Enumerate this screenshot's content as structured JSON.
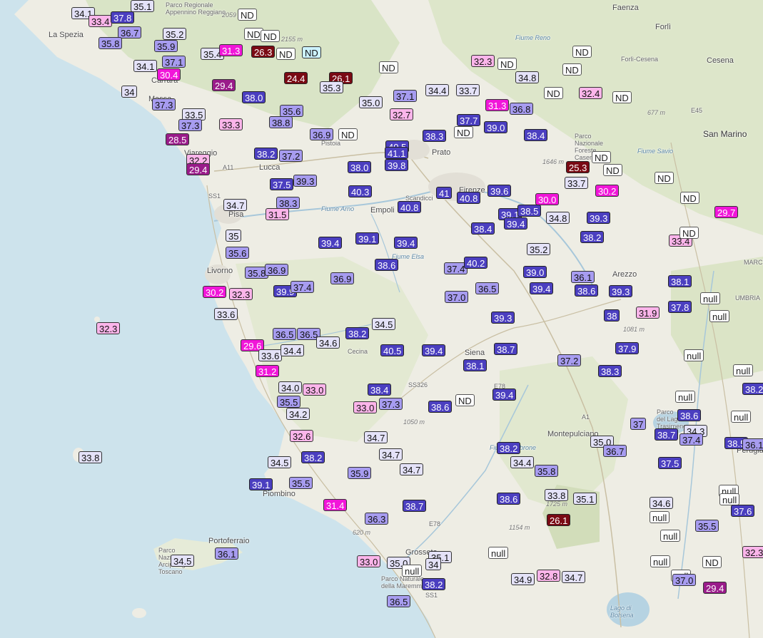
{
  "places": [
    {
      "name": "Parco Regionale\nAppennino Reggiano",
      "cls": "small"
    },
    {
      "name": "La Spezia",
      "cls": ""
    },
    {
      "name": "Carrara",
      "cls": ""
    },
    {
      "name": "Lucca",
      "cls": ""
    },
    {
      "name": "Pistoia",
      "cls": "small"
    },
    {
      "name": "Prato",
      "cls": ""
    },
    {
      "name": "Firenze",
      "cls": ""
    },
    {
      "name": "Pisa",
      "cls": ""
    },
    {
      "name": "Scandicci",
      "cls": "small"
    },
    {
      "name": "Empoli",
      "cls": ""
    },
    {
      "name": "Livorno",
      "cls": ""
    },
    {
      "name": "Siena",
      "cls": ""
    },
    {
      "name": "Arezzo",
      "cls": ""
    },
    {
      "name": "Faenza",
      "cls": ""
    },
    {
      "name": "Forlì",
      "cls": ""
    },
    {
      "name": "Cesena",
      "cls": ""
    },
    {
      "name": "Forlì-Cesena",
      "cls": "small"
    },
    {
      "name": "San Marino",
      "cls": "big"
    },
    {
      "name": "Parco\nNazionale\nForeste\nCasentino",
      "cls": "small"
    },
    {
      "name": "Montepulciano",
      "cls": ""
    },
    {
      "name": "Piombino",
      "cls": ""
    },
    {
      "name": "Portoferraio",
      "cls": ""
    },
    {
      "name": "Parco\nNazionale\nArcipelago\nToscano",
      "cls": "small"
    },
    {
      "name": "Grosseto",
      "cls": ""
    },
    {
      "name": "Parco Naturale\ndella Maremma",
      "cls": "small"
    },
    {
      "name": "Lago di\nBolsena",
      "cls": "water"
    },
    {
      "name": "Perugia",
      "cls": ""
    },
    {
      "name": "Parco\ndel Lago\nTrasimeno",
      "cls": "small"
    },
    {
      "name": "UMBRIA",
      "cls": "small"
    },
    {
      "name": "MARCHE",
      "cls": "small"
    },
    {
      "name": "Fiume Arno",
      "cls": "water"
    },
    {
      "name": "Fiume Reno",
      "cls": "water"
    },
    {
      "name": "Fiume Savio",
      "cls": "water"
    },
    {
      "name": "Fiume Elsa",
      "cls": "water"
    },
    {
      "name": "Fiume Ombrone",
      "cls": "water"
    },
    {
      "name": "Cecina",
      "cls": "small"
    },
    {
      "name": "Massa",
      "cls": ""
    },
    {
      "name": "Viareggio",
      "cls": ""
    },
    {
      "name": "A11",
      "cls": "small"
    },
    {
      "name": "A1",
      "cls": "small"
    },
    {
      "name": "E45",
      "cls": "small"
    },
    {
      "name": "E78",
      "cls": "small"
    },
    {
      "name": "SS1",
      "cls": "small"
    },
    {
      "name": "SS1",
      "cls": "small"
    },
    {
      "name": "SS326",
      "cls": "small"
    },
    {
      "name": "E78",
      "cls": "small"
    }
  ],
  "elevations": [
    "2059 m",
    "2155 m",
    "1646 m",
    "677 m",
    "1050 m",
    "1081 m",
    "1154 m",
    "1725 m",
    "620 m"
  ],
  "stations": [
    {
      "v": "34.1",
      "c": "c1"
    },
    {
      "v": "33.4",
      "c": "c4"
    },
    {
      "v": "37.8",
      "c": "c3"
    },
    {
      "v": "35.1",
      "c": "c1"
    },
    {
      "v": "36.7",
      "c": "c2"
    },
    {
      "v": "35.8",
      "c": "c2"
    },
    {
      "v": "35.2",
      "c": "c1"
    },
    {
      "v": "35.9",
      "c": "c2"
    },
    {
      "v": "37.1",
      "c": "c2"
    },
    {
      "v": "34.1",
      "c": "c1"
    },
    {
      "v": "30.4",
      "c": "c5"
    },
    {
      "v": "34",
      "c": "c1"
    },
    {
      "v": "29.4",
      "c": "c6"
    },
    {
      "v": "37.3",
      "c": "c2"
    },
    {
      "v": "33.5",
      "c": "c1"
    },
    {
      "v": "37.3",
      "c": "c2"
    },
    {
      "v": "28.5",
      "c": "c6"
    },
    {
      "v": "35.4",
      "c": "c1"
    },
    {
      "v": "31.3",
      "c": "c5"
    },
    {
      "v": "26.3",
      "c": "c7"
    },
    {
      "v": "ND",
      "c": "nd"
    },
    {
      "v": "ND",
      "c": "nd"
    },
    {
      "v": "ND",
      "c": "nd"
    },
    {
      "v": "ND",
      "c": "nd"
    },
    {
      "v": "ND",
      "c": "c8"
    },
    {
      "v": "24.4",
      "c": "c7"
    },
    {
      "v": "26.1",
      "c": "c7"
    },
    {
      "v": "35.3",
      "c": "c1"
    },
    {
      "v": "ND",
      "c": "nd"
    },
    {
      "v": "38.0",
      "c": "c3"
    },
    {
      "v": "35.0",
      "c": "c1"
    },
    {
      "v": "35.6",
      "c": "c2"
    },
    {
      "v": "38.8",
      "c": "c2"
    },
    {
      "v": "33.3",
      "c": "c4"
    },
    {
      "v": "36.9",
      "c": "c2"
    },
    {
      "v": "ND",
      "c": "nd"
    },
    {
      "v": "37.1",
      "c": "c2"
    },
    {
      "v": "34.4",
      "c": "c1"
    },
    {
      "v": "33.7",
      "c": "c1"
    },
    {
      "v": "32.3",
      "c": "c4"
    },
    {
      "v": "ND",
      "c": "nd"
    },
    {
      "v": "34.8",
      "c": "c1"
    },
    {
      "v": "ND",
      "c": "nd"
    },
    {
      "v": "ND",
      "c": "nd"
    },
    {
      "v": "32.4",
      "c": "c4"
    },
    {
      "v": "32.7",
      "c": "c4"
    },
    {
      "v": "31.3",
      "c": "c5"
    },
    {
      "v": "36.8",
      "c": "c2"
    },
    {
      "v": "ND",
      "c": "nd"
    },
    {
      "v": "ND",
      "c": "nd"
    },
    {
      "v": "37.7",
      "c": "c3"
    },
    {
      "v": "ND",
      "c": "nd"
    },
    {
      "v": "38.3",
      "c": "c3"
    },
    {
      "v": "39.0",
      "c": "c3"
    },
    {
      "v": "38.4",
      "c": "c3"
    },
    {
      "v": "40.5",
      "c": "c3"
    },
    {
      "v": "41.1",
      "c": "c3"
    },
    {
      "v": "39.8",
      "c": "c3"
    },
    {
      "v": "38.2",
      "c": "c3"
    },
    {
      "v": "37.2",
      "c": "c2"
    },
    {
      "v": "32.2",
      "c": "c4"
    },
    {
      "v": "29.4",
      "c": "c6"
    },
    {
      "v": "38.0",
      "c": "c3"
    },
    {
      "v": "37.5",
      "c": "c3"
    },
    {
      "v": "39.3",
      "c": "c2"
    },
    {
      "v": "40.3",
      "c": "c3"
    },
    {
      "v": "40.8",
      "c": "c3"
    },
    {
      "v": "38.3",
      "c": "c2"
    },
    {
      "v": "34.7",
      "c": "c1"
    },
    {
      "v": "31.5",
      "c": "c4"
    },
    {
      "v": "41",
      "c": "c3"
    },
    {
      "v": "40.8",
      "c": "c3"
    },
    {
      "v": "39.6",
      "c": "c3"
    },
    {
      "v": "30.0",
      "c": "c5"
    },
    {
      "v": "34.8",
      "c": "c1"
    },
    {
      "v": "25.3",
      "c": "c7"
    },
    {
      "v": "ND",
      "c": "nd"
    },
    {
      "v": "ND",
      "c": "nd"
    },
    {
      "v": "33.7",
      "c": "c1"
    },
    {
      "v": "30.2",
      "c": "c5"
    },
    {
      "v": "ND",
      "c": "nd"
    },
    {
      "v": "ND",
      "c": "nd"
    },
    {
      "v": "29.7",
      "c": "c5"
    },
    {
      "v": "39.1",
      "c": "c3"
    },
    {
      "v": "38.5",
      "c": "c3"
    },
    {
      "v": "38.4",
      "c": "c3"
    },
    {
      "v": "39.4",
      "c": "c3"
    },
    {
      "v": "39.3",
      "c": "c3"
    },
    {
      "v": "38.2",
      "c": "c3"
    },
    {
      "v": "33.4",
      "c": "c4"
    },
    {
      "v": "ND",
      "c": "nd"
    },
    {
      "v": "35",
      "c": "c1"
    },
    {
      "v": "35.6",
      "c": "c2"
    },
    {
      "v": "39.4",
      "c": "c3"
    },
    {
      "v": "39.1",
      "c": "c3"
    },
    {
      "v": "39.4",
      "c": "c3"
    },
    {
      "v": "35.2",
      "c": "c1"
    },
    {
      "v": "35.8",
      "c": "c2"
    },
    {
      "v": "36.9",
      "c": "c2"
    },
    {
      "v": "38.6",
      "c": "c3"
    },
    {
      "v": "37.4",
      "c": "c2"
    },
    {
      "v": "40.2",
      "c": "c3"
    },
    {
      "v": "39.0",
      "c": "c3"
    },
    {
      "v": "36.1",
      "c": "c2"
    },
    {
      "v": "38.1",
      "c": "c3"
    },
    {
      "v": "30.2",
      "c": "c5"
    },
    {
      "v": "32.3",
      "c": "c4"
    },
    {
      "v": "39.9",
      "c": "c3"
    },
    {
      "v": "37.4",
      "c": "c2"
    },
    {
      "v": "36.9",
      "c": "c2"
    },
    {
      "v": "37.0",
      "c": "c2"
    },
    {
      "v": "36.5",
      "c": "c2"
    },
    {
      "v": "39.4",
      "c": "c3"
    },
    {
      "v": "38.6",
      "c": "c3"
    },
    {
      "v": "39.3",
      "c": "c3"
    },
    {
      "v": "null",
      "c": "nd"
    },
    {
      "v": "33.6",
      "c": "c1"
    },
    {
      "v": "32.3",
      "c": "c4"
    },
    {
      "v": "39.3",
      "c": "c3"
    },
    {
      "v": "38",
      "c": "c3"
    },
    {
      "v": "31.9",
      "c": "c4"
    },
    {
      "v": "37.8",
      "c": "c3"
    },
    {
      "v": "null",
      "c": "nd"
    },
    {
      "v": "34.5",
      "c": "c1"
    },
    {
      "v": "36.5",
      "c": "c2"
    },
    {
      "v": "36.5",
      "c": "c2"
    },
    {
      "v": "38.2",
      "c": "c3"
    },
    {
      "v": "29.6",
      "c": "c5"
    },
    {
      "v": "33.6",
      "c": "c1"
    },
    {
      "v": "34.4",
      "c": "c1"
    },
    {
      "v": "34.6",
      "c": "c1"
    },
    {
      "v": "40.5",
      "c": "c3"
    },
    {
      "v": "39.4",
      "c": "c3"
    },
    {
      "v": "38.7",
      "c": "c3"
    },
    {
      "v": "37.9",
      "c": "c3"
    },
    {
      "v": "null",
      "c": "nd"
    },
    {
      "v": "31.2",
      "c": "c5"
    },
    {
      "v": "37.2",
      "c": "c2"
    },
    {
      "v": "38.3",
      "c": "c3"
    },
    {
      "v": "38.1",
      "c": "c3"
    },
    {
      "v": "null",
      "c": "nd"
    },
    {
      "v": "34.0",
      "c": "c1"
    },
    {
      "v": "33.0",
      "c": "c4"
    },
    {
      "v": "38.4",
      "c": "c3"
    },
    {
      "v": "38.2",
      "c": "c3"
    },
    {
      "v": "35.5",
      "c": "c2"
    },
    {
      "v": "33.0",
      "c": "c4"
    },
    {
      "v": "37.3",
      "c": "c2"
    },
    {
      "v": "38.6",
      "c": "c3"
    },
    {
      "v": "ND",
      "c": "nd"
    },
    {
      "v": "39.4",
      "c": "c3"
    },
    {
      "v": "null",
      "c": "nd"
    },
    {
      "v": "34.2",
      "c": "c1"
    },
    {
      "v": "38.6",
      "c": "c3"
    },
    {
      "v": "null",
      "c": "nd"
    },
    {
      "v": "37",
      "c": "c2"
    },
    {
      "v": "38.7",
      "c": "c3"
    },
    {
      "v": "34.3",
      "c": "c1"
    },
    {
      "v": "32.6",
      "c": "c4"
    },
    {
      "v": "34.7",
      "c": "c1"
    },
    {
      "v": "37.4",
      "c": "c2"
    },
    {
      "v": "38.5",
      "c": "c3"
    },
    {
      "v": "36.1",
      "c": "c2"
    },
    {
      "v": "35.0",
      "c": "c1"
    },
    {
      "v": "36.7",
      "c": "c2"
    },
    {
      "v": "33.8",
      "c": "c1"
    },
    {
      "v": "34.7",
      "c": "c1"
    },
    {
      "v": "38.2",
      "c": "c3"
    },
    {
      "v": "34.5",
      "c": "c1"
    },
    {
      "v": "38.2",
      "c": "c3"
    },
    {
      "v": "34.4",
      "c": "c1"
    },
    {
      "v": "37.5",
      "c": "c3"
    },
    {
      "v": "35.9",
      "c": "c2"
    },
    {
      "v": "34.7",
      "c": "c1"
    },
    {
      "v": "35.8",
      "c": "c2"
    },
    {
      "v": "null",
      "c": "nd"
    },
    {
      "v": "null",
      "c": "nd"
    },
    {
      "v": "39.1",
      "c": "c3"
    },
    {
      "v": "35.5",
      "c": "c2"
    },
    {
      "v": "38.6",
      "c": "c3"
    },
    {
      "v": "33.8",
      "c": "c1"
    },
    {
      "v": "35.1",
      "c": "c1"
    },
    {
      "v": "34.6",
      "c": "c1"
    },
    {
      "v": "37.6",
      "c": "c3"
    },
    {
      "v": "31.4",
      "c": "c5"
    },
    {
      "v": "38.7",
      "c": "c3"
    },
    {
      "v": "36.3",
      "c": "c2"
    },
    {
      "v": "26.1",
      "c": "c7"
    },
    {
      "v": "null",
      "c": "nd"
    },
    {
      "v": "35.5",
      "c": "c2"
    },
    {
      "v": "null",
      "c": "nd"
    },
    {
      "v": "32.3",
      "c": "c4"
    },
    {
      "v": "34.5",
      "c": "c1"
    },
    {
      "v": "36.1",
      "c": "c2"
    },
    {
      "v": "null",
      "c": "nd"
    },
    {
      "v": "null",
      "c": "nd"
    },
    {
      "v": "ND",
      "c": "nd"
    },
    {
      "v": "33.0",
      "c": "c4"
    },
    {
      "v": "35.0",
      "c": "c1"
    },
    {
      "v": "35.1",
      "c": "c1"
    },
    {
      "v": "34",
      "c": "c1"
    },
    {
      "v": "null",
      "c": "nd"
    },
    {
      "v": "null",
      "c": "nd"
    },
    {
      "v": "37.0",
      "c": "c2"
    },
    {
      "v": "34.9",
      "c": "c1"
    },
    {
      "v": "32.8",
      "c": "c4"
    },
    {
      "v": "34.7",
      "c": "c1"
    },
    {
      "v": "38.2",
      "c": "c3"
    },
    {
      "v": "29.4",
      "c": "c6"
    },
    {
      "v": "36.5",
      "c": "c2"
    }
  ],
  "colors": {
    "sea": "#cde3ec",
    "land": "#f0efe6",
    "hills": "#dfe8cc",
    "highlands": "#cfdcb6"
  }
}
